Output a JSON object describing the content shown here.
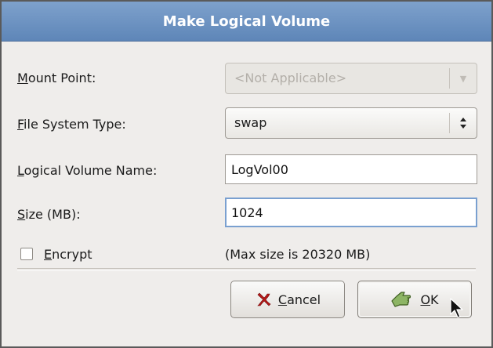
{
  "dialog": {
    "title": "Make Logical Volume"
  },
  "mount_point": {
    "label_mnemonic": "M",
    "label_rest": "ount Point:",
    "value": "<Not Applicable>",
    "disabled": true
  },
  "file_system_type": {
    "label_mnemonic": "F",
    "label_rest": "ile System Type:",
    "value": "swap"
  },
  "volume_name": {
    "label_mnemonic": "L",
    "label_rest": "ogical Volume Name:",
    "value": "LogVol00"
  },
  "size": {
    "label_mnemonic": "S",
    "label_rest": "ize (MB):",
    "value": "1024"
  },
  "encrypt": {
    "label_mnemonic": "E",
    "label_rest": "ncrypt",
    "checked": false
  },
  "max_size_text": "(Max size is 20320 MB)",
  "buttons": {
    "cancel": {
      "mnemonic": "C",
      "rest": "ancel",
      "icon": "x-icon"
    },
    "ok": {
      "mnemonic": "O",
      "rest": "K",
      "icon": "ok-hand-icon"
    }
  },
  "colors": {
    "titlebar": "#6d93c2",
    "dialog_bg": "#efedeb",
    "cancel_icon": "#b81818",
    "ok_icon": "#7fa35a"
  }
}
